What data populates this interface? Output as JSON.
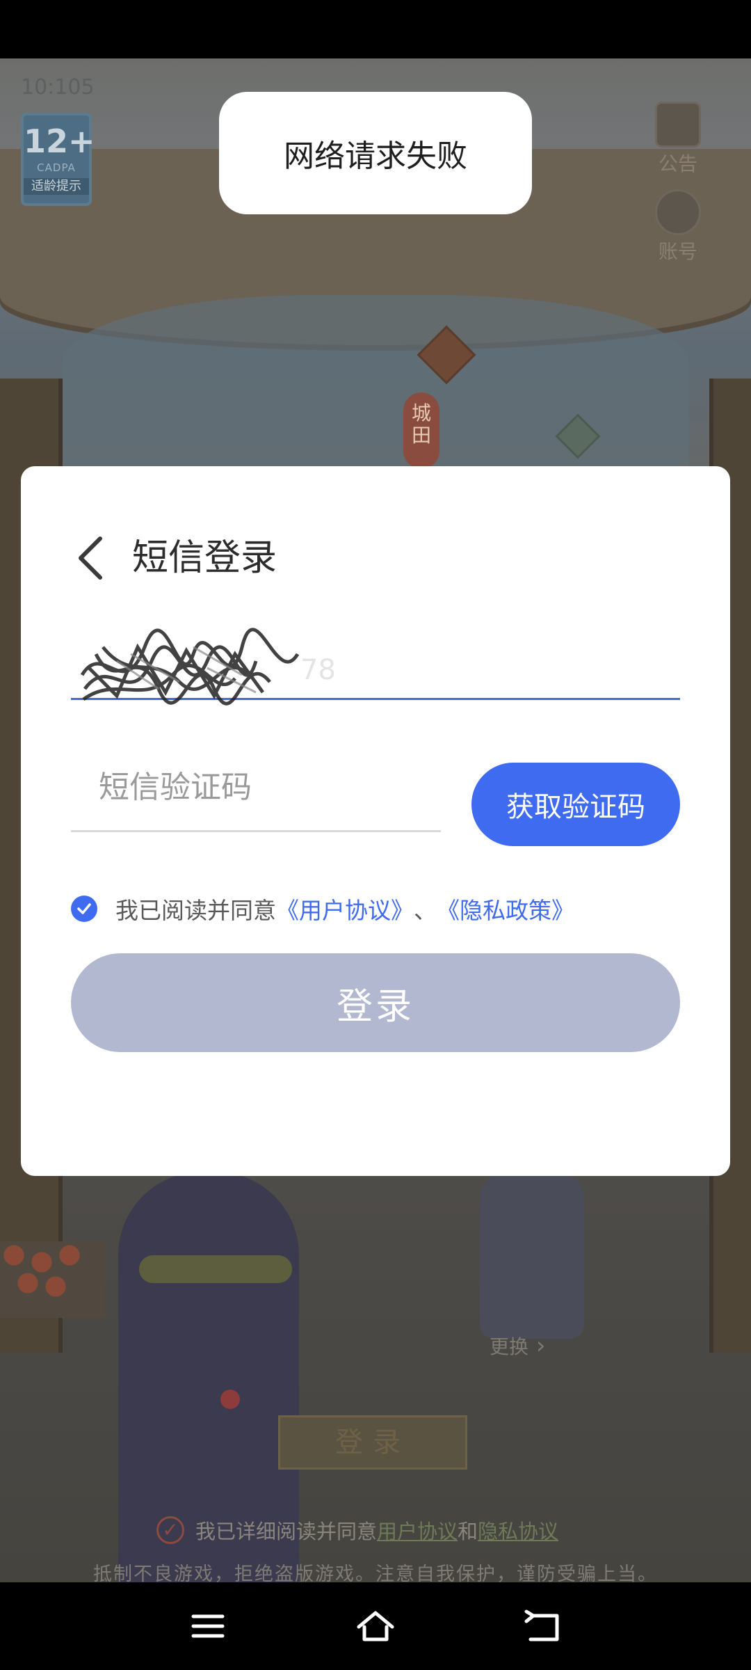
{
  "toast": {
    "message": "网络请求失败"
  },
  "game": {
    "time": "10:105",
    "age_rating": {
      "age": "12+",
      "org": "CADPA",
      "hint": "适龄提示"
    },
    "hud": {
      "announcement": "公告",
      "account": "账号"
    },
    "lantern": "城田",
    "change_label": "更换",
    "login_label": "登录",
    "agree": {
      "prefix": "我已详细阅读并同意",
      "user_agreement": "用户协议",
      "and": "和",
      "privacy": "隐私协议"
    },
    "anti_addiction": "抵制不良游戏，拒绝盗版游戏。注意自我保护，谨防受骗上当。"
  },
  "dialog": {
    "title": "短信登录",
    "phone_value_visible": "78",
    "code_placeholder": "短信验证码",
    "get_code_label": "获取验证码",
    "agree": {
      "prefix": "我已阅读并同意",
      "user_agreement": "《用户协议》",
      "separator": "、",
      "privacy_policy": "《隐私政策》",
      "checked": true
    },
    "login_label": "登录"
  },
  "colors": {
    "accent": "#3f6bf0",
    "login_disabled": "#b1b8cf",
    "toast_bg": "#ffffff"
  },
  "nav": {
    "icons": [
      "menu-icon",
      "home-icon",
      "back-icon"
    ]
  }
}
